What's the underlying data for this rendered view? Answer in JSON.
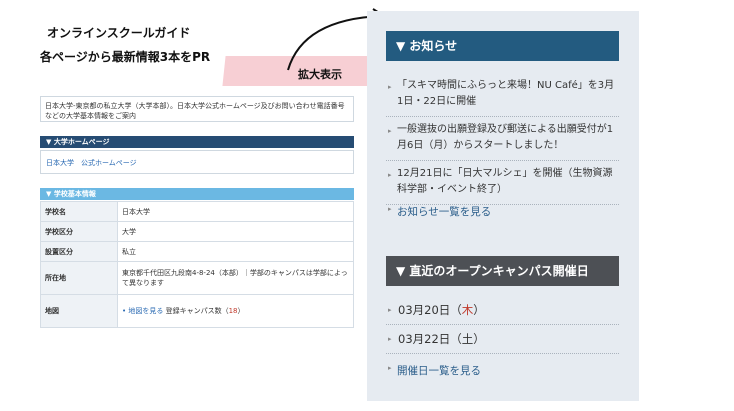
{
  "captions": {
    "line1": "オンラインスクールガイド",
    "line2": "各ページから最新情報3本をPR",
    "zoom_label": "拡大表示"
  },
  "mini_page": {
    "intro": "日本大学-東京都の私立大学（大学本部）。日本大学公式ホームページ及びお問い合わせ電話番号などの大学基本情報をご案内",
    "homepage_header": "▼ 大学ホームページ",
    "homepage_link": "日本大学　公式ホームページ",
    "info_header": "▼ 学校基本情報",
    "rows": [
      {
        "key": "学校名",
        "value": "日本大学"
      },
      {
        "key": "学校区分",
        "value": "大学"
      },
      {
        "key": "設置区分",
        "value": "私立"
      },
      {
        "key": "所在地",
        "value": "東京都千代田区九段南4-8-24（本部）｜学部のキャンパスは学部によって異なります"
      }
    ],
    "map_row": {
      "key": "地図",
      "link": "• 地図を見る",
      "campus": "登録キャンパス数（",
      "campus_count": "18",
      "campus_close": "）"
    }
  },
  "news": {
    "header": "▼ お知らせ",
    "items": [
      "「スキマ時間にふらっと来場！NU Café」を3月1日・22日に開催",
      "一般選抜の出願登録及び郵送による出願受付が1月6日（月）からスタートしました！",
      "12月21日に「日大マルシェ」を開催（生物資源科学部・イベント終了）"
    ],
    "more": "お知らせ一覧を見る"
  },
  "open_campus": {
    "header": "▼ 直近のオープンキャンパス開催日",
    "dates": [
      {
        "date": "03月20日（",
        "weekday": "木",
        "close": "）",
        "weekday_color": "#c0392b"
      },
      {
        "date": "03月22日（",
        "weekday": "土",
        "close": "）",
        "weekday_color": "#333333"
      }
    ],
    "more": "開催日一覧を見る"
  },
  "colors": {
    "news_bar": "#235b80",
    "open_campus_bar": "#4d5055",
    "panel_bg": "#e6ebf1",
    "zoom_label_bg": "#f7cfd4"
  }
}
